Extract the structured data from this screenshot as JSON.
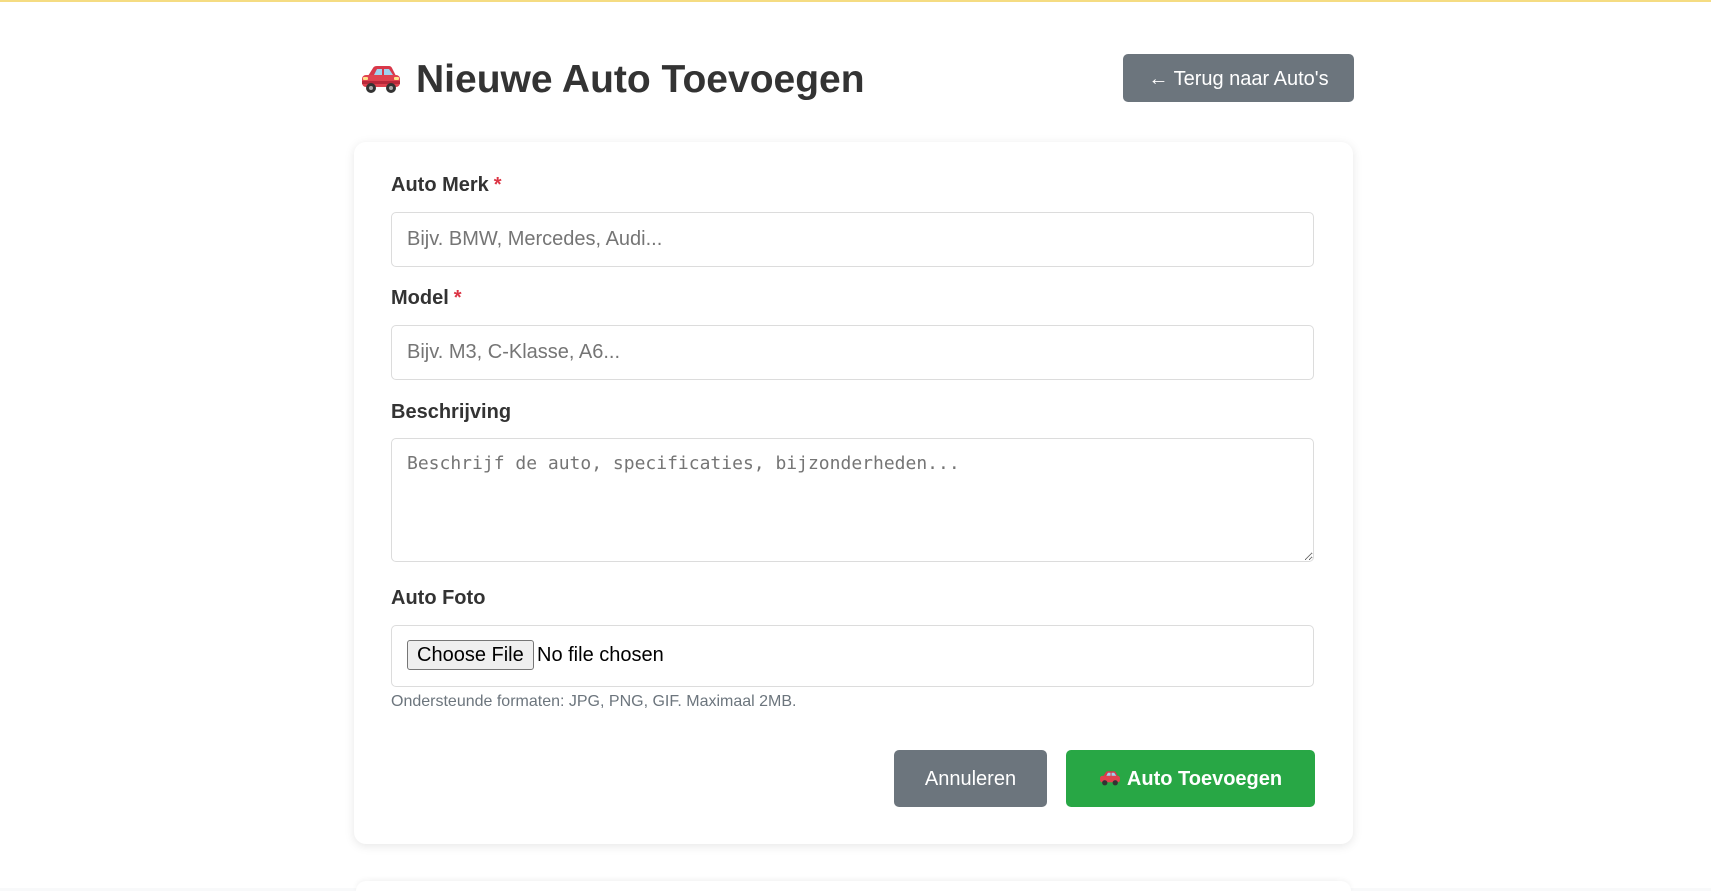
{
  "header": {
    "title": "Nieuwe Auto Toevoegen",
    "title_icon": "car-icon",
    "back_button_label": "← Terug naar Auto's"
  },
  "form": {
    "brand": {
      "label": "Auto Merk",
      "required_marker": "*",
      "placeholder": "Bijv. BMW, Mercedes, Audi...",
      "value": ""
    },
    "model": {
      "label": "Model",
      "required_marker": "*",
      "placeholder": "Bijv. M3, C-Klasse, A6...",
      "value": ""
    },
    "description": {
      "label": "Beschrijving",
      "placeholder": "Beschrijf de auto, specificaties, bijzonderheden...",
      "value": ""
    },
    "photo": {
      "label": "Auto Foto",
      "button_label": "Choose File",
      "status": "No file chosen",
      "hint": "Ondersteunde formaten: JPG, PNG, GIF. Maximaal 2MB."
    },
    "actions": {
      "cancel_label": "Annuleren",
      "submit_label": "Auto Toevoegen",
      "submit_icon": "car-icon"
    }
  },
  "colors": {
    "accent_green": "#28a745",
    "secondary_gray": "#6c757d",
    "required_red": "#dc3545",
    "top_line": "#f5dc82"
  }
}
